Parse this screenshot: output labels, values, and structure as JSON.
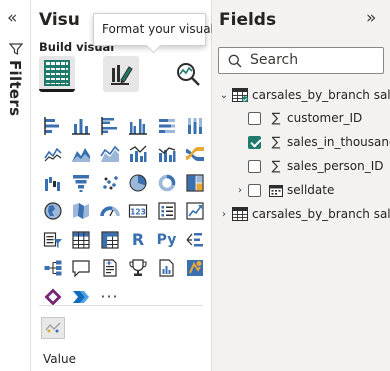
{
  "filters_pane": {
    "label": "Filters",
    "collapse_glyph": "«"
  },
  "visualizations": {
    "title": "Visu",
    "expand_glyph": "»",
    "tab_label": "Build visual",
    "tooltip": "Format your visual",
    "modes": [
      "build-visual-icon",
      "format-visual-icon",
      "analytics-icon"
    ],
    "r_label": "R",
    "py_label": "Py",
    "more_label": "···",
    "value_label": "Value",
    "colors": {
      "accent": "#2b579a",
      "teal": "#1f7a6b",
      "blue": "#3a6fb0"
    }
  },
  "fields": {
    "title": "Fields",
    "expand_glyph": "»",
    "search_placeholder": "Search",
    "tables": [
      {
        "name": "carsales_by_branch sale...",
        "expanded": true,
        "fields": [
          {
            "name": "customer_ID",
            "checked": false
          },
          {
            "name": "sales_in_thousand",
            "checked": true
          },
          {
            "name": "sales_person_ID",
            "checked": false
          },
          {
            "name": "selldate",
            "checked": false,
            "type": "date"
          }
        ]
      },
      {
        "name": "carsales_by_branch sale...",
        "expanded": false
      }
    ]
  }
}
